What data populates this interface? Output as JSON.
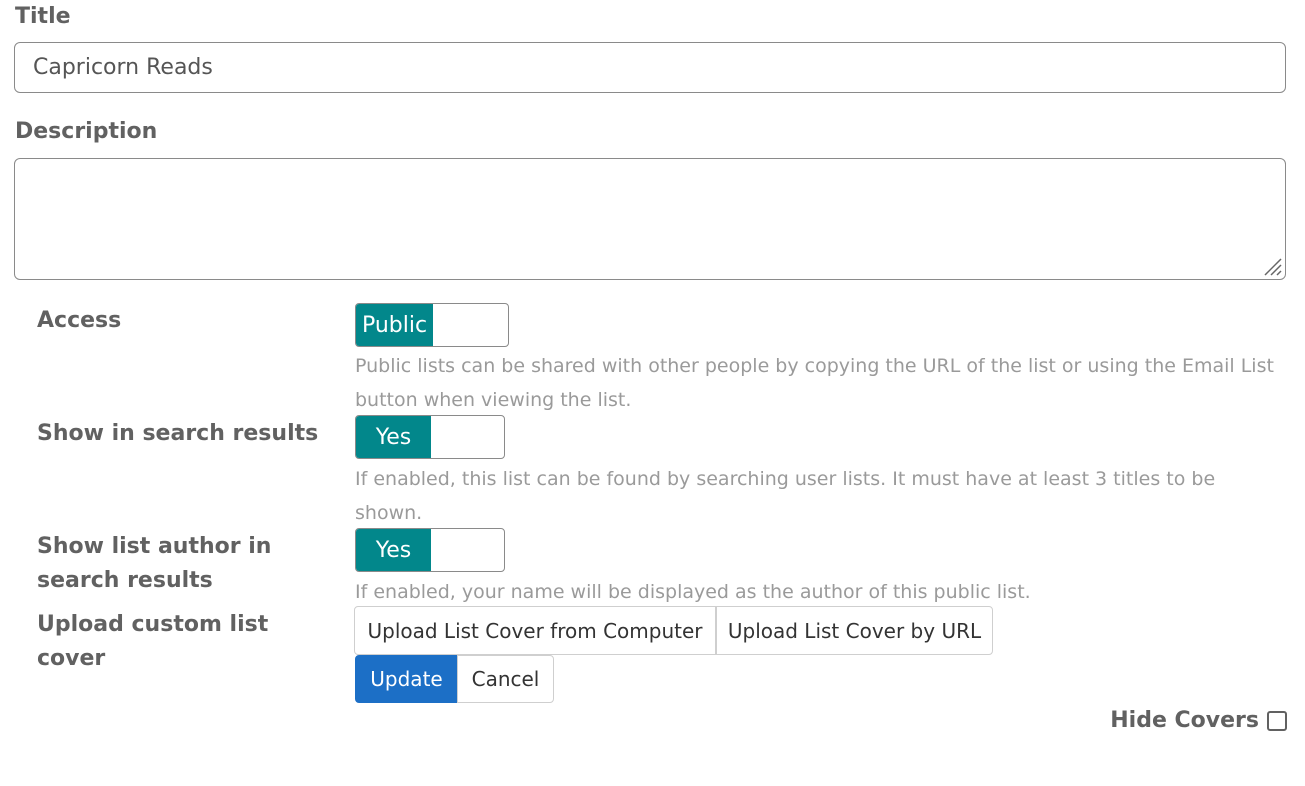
{
  "title_field": {
    "label": "Title",
    "value": "Capricorn Reads"
  },
  "description_field": {
    "label": "Description",
    "value": ""
  },
  "access": {
    "label": "Access",
    "toggle_label": "Public",
    "help": "Public lists can be shared with other people by copying the URL of the list or using the Email List button when viewing the list."
  },
  "show_in_search": {
    "label": "Show in search results",
    "toggle_label": "Yes",
    "help": "If enabled, this list can be found by searching user lists. It must have at least 3 titles to be shown."
  },
  "show_author": {
    "label": "Show list author in search results",
    "toggle_label": "Yes",
    "help": "If enabled, your name will be displayed as the author of this public list."
  },
  "upload_cover": {
    "label": "Upload custom list cover",
    "from_computer": "Upload List Cover from Computer",
    "by_url": "Upload List Cover by URL"
  },
  "actions": {
    "update": "Update",
    "cancel": "Cancel"
  },
  "hide_covers": {
    "label": "Hide Covers",
    "checked": false
  },
  "colors": {
    "toggle_on": "#02878b",
    "primary": "#1c6fc6"
  }
}
